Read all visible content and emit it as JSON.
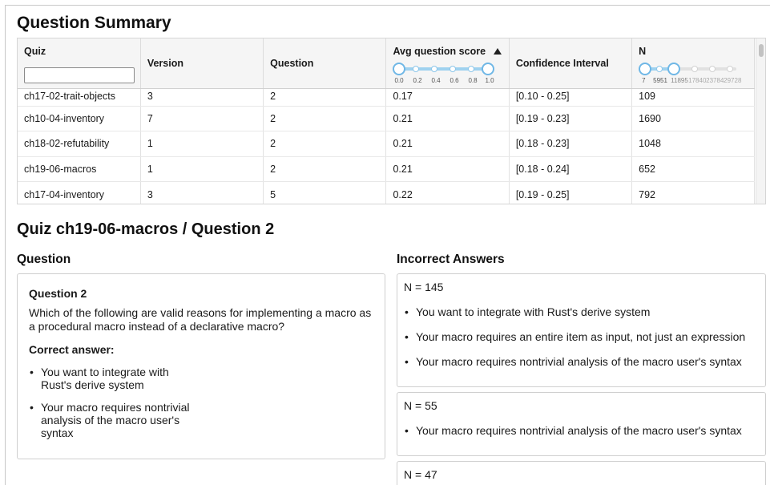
{
  "summary": {
    "title": "Question Summary",
    "columns": [
      "Quiz",
      "Version",
      "Question",
      "Avg question score",
      "Confidence Interval",
      "N"
    ],
    "filter_value": "",
    "score_slider_labels": [
      "0.0",
      "0.2",
      "0.4",
      "0.6",
      "0.8",
      "1.0"
    ],
    "n_slider_labels": [
      "7",
      "5951",
      "11895",
      "17840",
      "23784",
      "29728"
    ],
    "rows": [
      [
        "ch17-02-trait-objects",
        "3",
        "2",
        "0.17",
        "[0.10 - 0.25]",
        "109"
      ],
      [
        "ch10-04-inventory",
        "7",
        "2",
        "0.21",
        "[0.19 - 0.23]",
        "1690"
      ],
      [
        "ch18-02-refutability",
        "1",
        "2",
        "0.21",
        "[0.18 - 0.23]",
        "1048"
      ],
      [
        "ch19-06-macros",
        "1",
        "2",
        "0.21",
        "[0.18 - 0.24]",
        "652"
      ],
      [
        "ch17-04-inventory",
        "3",
        "5",
        "0.22",
        "[0.19 - 0.25]",
        "792"
      ]
    ]
  },
  "detail": {
    "title": "Quiz ch19-06-macros / Question 2",
    "question_heading": "Question",
    "question_label": "Question 2",
    "question_text": "Which of the following are valid reasons for implementing a macro as a procedural macro instead of a declarative macro?",
    "correct_heading": "Correct answer:",
    "correct_answers": [
      "You want to integrate with Rust's derive system",
      "Your macro requires nontrivial analysis of the macro user's syntax"
    ],
    "incorrect_heading": "Incorrect Answers",
    "incorrect": [
      {
        "n": "N = 145",
        "answers": [
          "You want to integrate with Rust's derive system",
          "Your macro requires an entire item as input, not just an expression",
          "Your macro requires nontrivial analysis of the macro user's syntax"
        ]
      },
      {
        "n": "N = 55",
        "answers": [
          "Your macro requires nontrivial analysis of the macro user's syntax"
        ]
      },
      {
        "n": "N = 47",
        "answers": []
      }
    ]
  }
}
